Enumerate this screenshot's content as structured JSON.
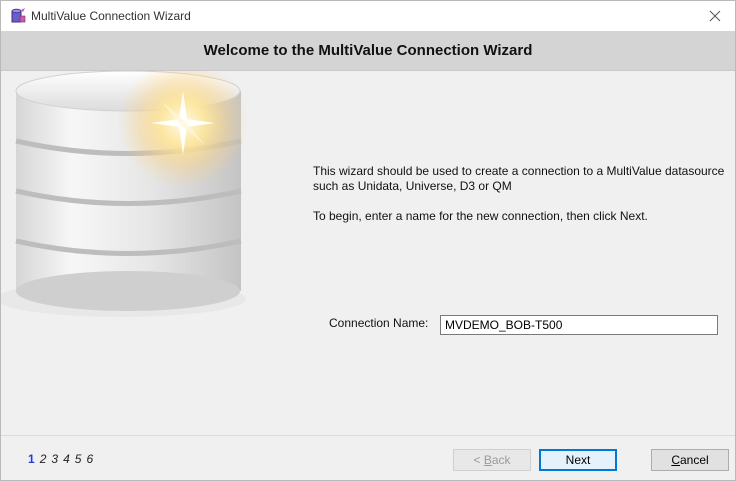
{
  "window": {
    "title": "MultiValue Connection Wizard"
  },
  "banner": {
    "heading": "Welcome to the MultiValue Connection Wizard"
  },
  "intro": {
    "line1": "This wizard should be used to create a connection to a MultiValue datasource such as Unidata, Universe, D3 or QM",
    "line2": "To begin, enter a name for the new connection, then click Next."
  },
  "form": {
    "connection_label": "Connection Name:",
    "connection_value": "MVDEMO_BOB-T500"
  },
  "steps": {
    "items": [
      "1",
      "2",
      "3",
      "4",
      "5",
      "6"
    ],
    "current": "1"
  },
  "buttons": {
    "back_prefix": "< ",
    "back_accel": "B",
    "back_rest": "ack",
    "next": "Next",
    "cancel_accel": "C",
    "cancel_rest": "ancel"
  },
  "icons": {
    "app": "wizard-app-icon",
    "close": "close-icon",
    "database": "database-illustration"
  }
}
